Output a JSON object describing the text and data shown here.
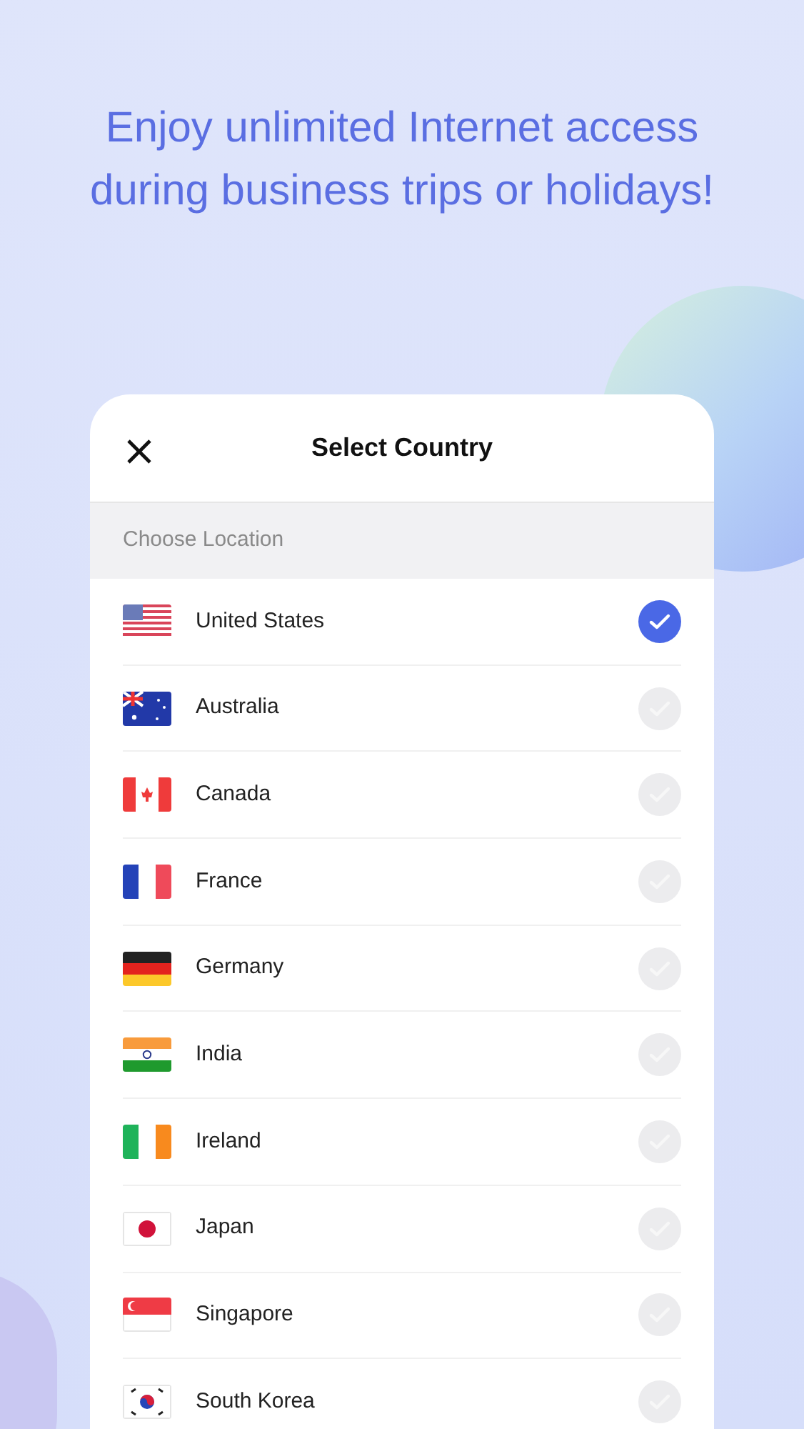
{
  "headline": "Enjoy unlimited Internet access during business trips or holidays!",
  "dialog": {
    "title": "Select Country",
    "section": "Choose Location",
    "countries": [
      {
        "name": "United States",
        "kind": "us",
        "selected": true
      },
      {
        "name": "Australia",
        "kind": "australia",
        "selected": false
      },
      {
        "name": "Canada",
        "kind": "canada",
        "selected": false
      },
      {
        "name": "France",
        "kind": "france",
        "selected": false
      },
      {
        "name": "Germany",
        "kind": "germany",
        "selected": false
      },
      {
        "name": "India",
        "kind": "india",
        "selected": false
      },
      {
        "name": "Ireland",
        "kind": "ireland",
        "selected": false
      },
      {
        "name": "Japan",
        "kind": "japan",
        "selected": false
      },
      {
        "name": "Singapore",
        "kind": "singapore",
        "selected": false
      },
      {
        "name": "South Korea",
        "kind": "korea",
        "selected": false
      }
    ]
  }
}
